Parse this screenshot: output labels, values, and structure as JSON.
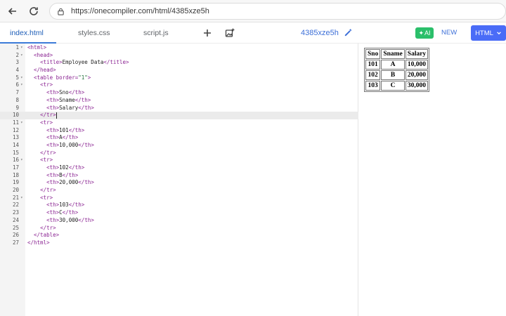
{
  "browser": {
    "url": "https://onecompiler.com/html/4385xze5h"
  },
  "toolbar": {
    "tabs": [
      {
        "label": "index.html"
      },
      {
        "label": "styles.css"
      },
      {
        "label": "script.js"
      }
    ],
    "project_name": "4385xze5h",
    "ai_label": "AI",
    "new_label": "NEW",
    "language_label": "HTML",
    "accent_color": "#4a6cf7"
  },
  "editor": {
    "lines": [
      {
        "n": "1",
        "fold": true,
        "text": "<html>"
      },
      {
        "n": "2",
        "fold": true,
        "text": "  <head>"
      },
      {
        "n": "3",
        "fold": false,
        "text": "    <title>Employee Data</title>"
      },
      {
        "n": "4",
        "fold": false,
        "text": "  </head>"
      },
      {
        "n": "5",
        "fold": true,
        "text": "  <table border=\"1\">"
      },
      {
        "n": "6",
        "fold": true,
        "text": "    <tr>"
      },
      {
        "n": "7",
        "fold": false,
        "text": "      <th>Sno</th>"
      },
      {
        "n": "8",
        "fold": false,
        "text": "      <th>Sname</th>"
      },
      {
        "n": "9",
        "fold": false,
        "text": "      <th>Salary</th>"
      },
      {
        "n": "10",
        "fold": false,
        "text": "    </tr>",
        "active": true
      },
      {
        "n": "11",
        "fold": true,
        "text": "    <tr>"
      },
      {
        "n": "12",
        "fold": false,
        "text": "      <th>101</th>"
      },
      {
        "n": "13",
        "fold": false,
        "text": "      <th>A</th>"
      },
      {
        "n": "14",
        "fold": false,
        "text": "      <th>10,000</th>"
      },
      {
        "n": "15",
        "fold": false,
        "text": "    </tr>"
      },
      {
        "n": "16",
        "fold": true,
        "text": "    <tr>"
      },
      {
        "n": "17",
        "fold": false,
        "text": "      <th>102</th>"
      },
      {
        "n": "18",
        "fold": false,
        "text": "      <th>B</th>"
      },
      {
        "n": "19",
        "fold": false,
        "text": "      <th>20,000</th>"
      },
      {
        "n": "20",
        "fold": false,
        "text": "    </tr>"
      },
      {
        "n": "21",
        "fold": true,
        "text": "    <tr>"
      },
      {
        "n": "22",
        "fold": false,
        "text": "      <th>103</th>"
      },
      {
        "n": "23",
        "fold": false,
        "text": "      <th>C</th>"
      },
      {
        "n": "24",
        "fold": false,
        "text": "      <th>30,000</th>"
      },
      {
        "n": "25",
        "fold": false,
        "text": "    </tr>"
      },
      {
        "n": "26",
        "fold": false,
        "text": "  </table>"
      },
      {
        "n": "27",
        "fold": false,
        "text": "</html>"
      }
    ]
  },
  "preview": {
    "headers": [
      "Sno",
      "Sname",
      "Salary"
    ],
    "rows": [
      [
        "101",
        "A",
        "10,000"
      ],
      [
        "102",
        "B",
        "20,000"
      ],
      [
        "103",
        "C",
        "30,000"
      ]
    ]
  }
}
